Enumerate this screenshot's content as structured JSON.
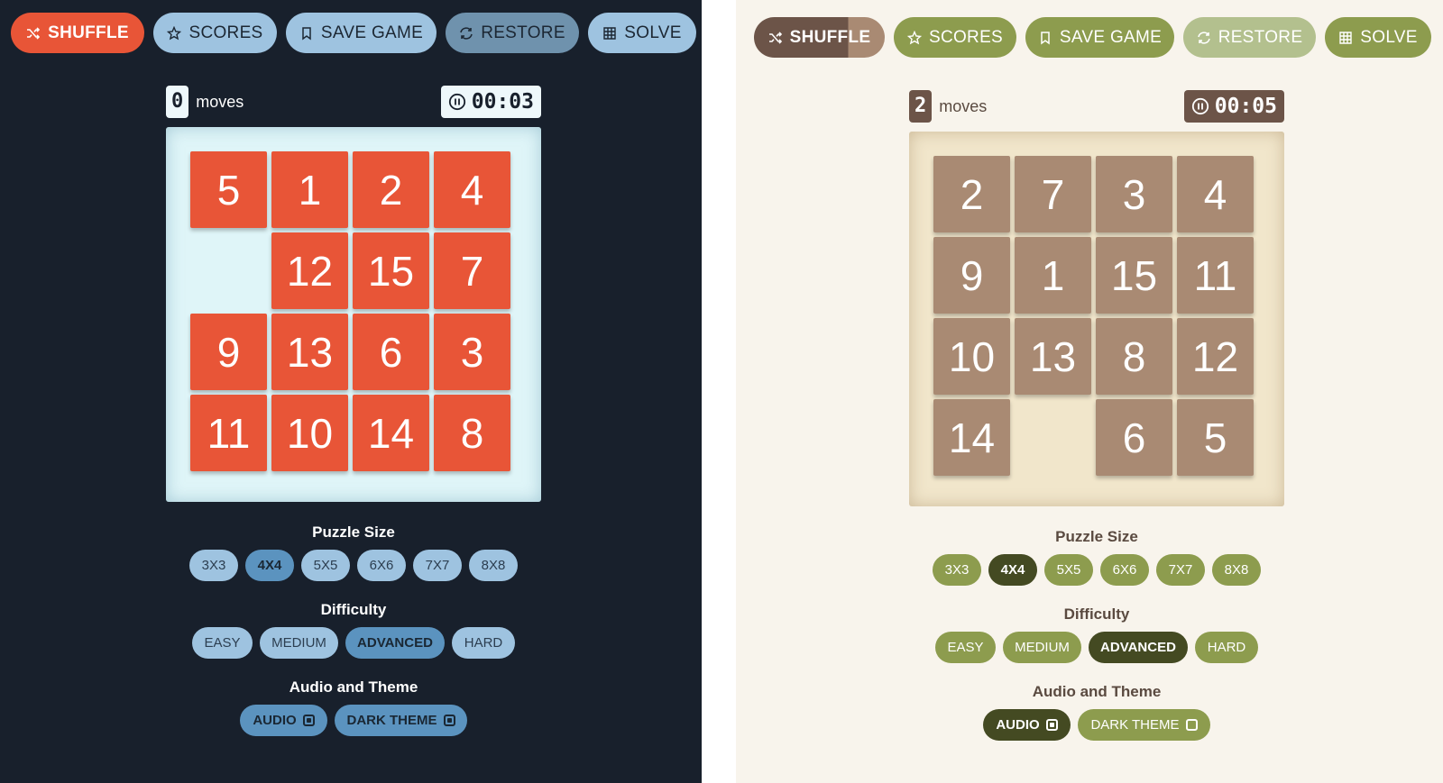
{
  "toolbar": {
    "shuffle": "SHUFFLE",
    "scores": "SCORES",
    "save": "SAVE GAME",
    "restore": "RESTORE",
    "solve": "SOLVE"
  },
  "labels": {
    "moves": "moves",
    "puzzle_size": "Puzzle Size",
    "difficulty": "Difficulty",
    "audio_theme": "Audio and Theme"
  },
  "sizes": [
    "3X3",
    "4X4",
    "5X5",
    "6X6",
    "7X7",
    "8X8"
  ],
  "difficulties": [
    "EASY",
    "MEDIUM",
    "ADVANCED",
    "HARD"
  ],
  "settings": {
    "audio": "AUDIO",
    "dark_theme": "DARK THEME"
  },
  "dark_game": {
    "moves": "0",
    "timer": "00:03",
    "selected_size": "4X4",
    "selected_difficulty": "ADVANCED",
    "audio_on": true,
    "dark_theme_on": true,
    "grid": [
      [
        "5",
        "1",
        "2",
        "4"
      ],
      [
        "",
        "12",
        "15",
        "7"
      ],
      [
        "9",
        "13",
        "6",
        "3"
      ],
      [
        "11",
        "10",
        "14",
        "8"
      ]
    ]
  },
  "light_game": {
    "moves": "2",
    "timer": "00:05",
    "selected_size": "4X4",
    "selected_difficulty": "ADVANCED",
    "audio_on": true,
    "dark_theme_on": false,
    "grid": [
      [
        "2",
        "7",
        "3",
        "4"
      ],
      [
        "9",
        "1",
        "15",
        "11"
      ],
      [
        "10",
        "13",
        "8",
        "12"
      ],
      [
        "14",
        "",
        "6",
        "5"
      ]
    ]
  },
  "colors": {
    "dark_accent": "#e85537",
    "dark_button": "#9ec3e0",
    "light_tile": "#a98a73",
    "light_button": "#8d9c4e",
    "light_selected": "#444a22"
  }
}
